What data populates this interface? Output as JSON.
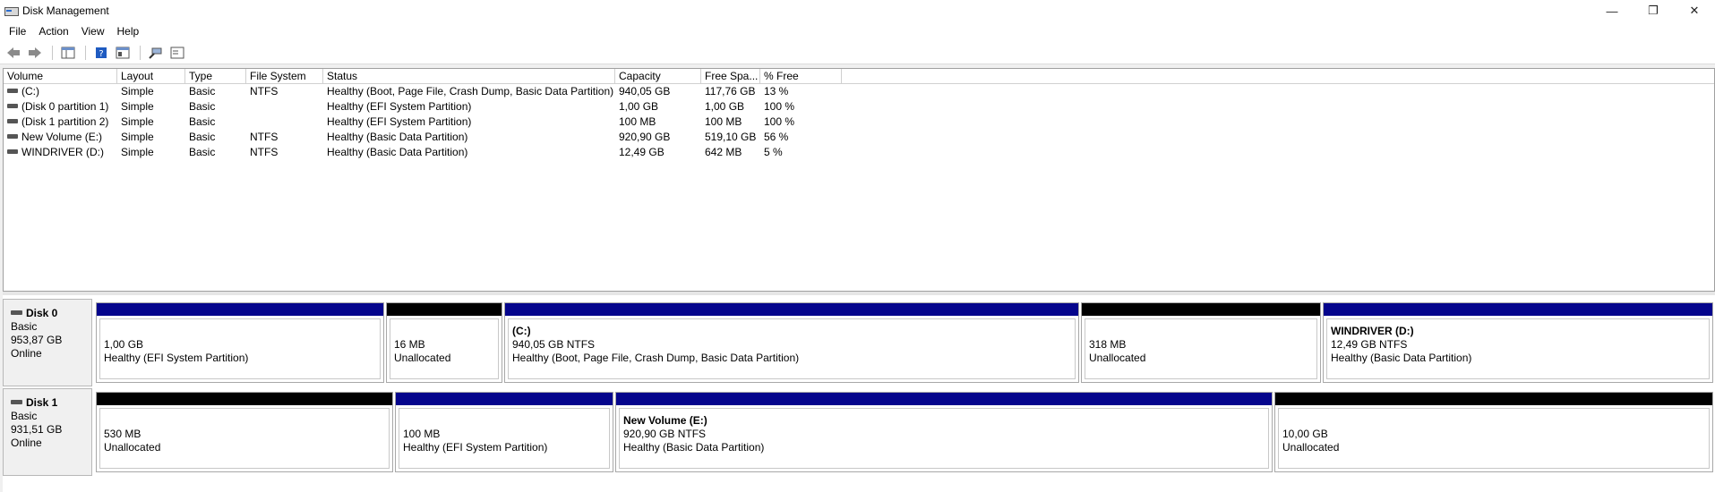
{
  "window": {
    "title": "Disk Management",
    "minimize": "—",
    "maximize": "❐",
    "close": "✕"
  },
  "menu": [
    "File",
    "Action",
    "View",
    "Help"
  ],
  "toolbar_icons": [
    "back-arrow-icon",
    "forward-arrow-icon",
    "console-tree-icon",
    "help-icon",
    "properties-icon",
    "rescan-icon",
    "disk-list-icon"
  ],
  "columns": [
    "Volume",
    "Layout",
    "Type",
    "File System",
    "Status",
    "Capacity",
    "Free Spa...",
    "% Free"
  ],
  "volumes": [
    {
      "volume": "(C:)",
      "layout": "Simple",
      "type": "Basic",
      "fs": "NTFS",
      "status": "Healthy (Boot, Page File, Crash Dump, Basic Data Partition)",
      "capacity": "940,05 GB",
      "free": "117,76 GB",
      "pct": "13 %"
    },
    {
      "volume": "(Disk 0 partition 1)",
      "layout": "Simple",
      "type": "Basic",
      "fs": "",
      "status": "Healthy (EFI System Partition)",
      "capacity": "1,00 GB",
      "free": "1,00 GB",
      "pct": "100 %"
    },
    {
      "volume": "(Disk 1 partition 2)",
      "layout": "Simple",
      "type": "Basic",
      "fs": "",
      "status": "Healthy (EFI System Partition)",
      "capacity": "100 MB",
      "free": "100 MB",
      "pct": "100 %"
    },
    {
      "volume": "New Volume (E:)",
      "layout": "Simple",
      "type": "Basic",
      "fs": "NTFS",
      "status": "Healthy (Basic Data Partition)",
      "capacity": "920,90 GB",
      "free": "519,10 GB",
      "pct": "56 %"
    },
    {
      "volume": "WINDRIVER (D:)",
      "layout": "Simple",
      "type": "Basic",
      "fs": "NTFS",
      "status": "Healthy (Basic Data Partition)",
      "capacity": "12,49 GB",
      "free": "642 MB",
      "pct": "5 %"
    }
  ],
  "disks": [
    {
      "name": "Disk 0",
      "type": "Basic",
      "size": "953,87 GB",
      "state": "Online",
      "partitions": [
        {
          "name": "",
          "size": "1,00 GB",
          "status": "Healthy (EFI System Partition)",
          "bar": "blue"
        },
        {
          "name": "",
          "size": "16 MB",
          "status": "Unallocated",
          "bar": "black"
        },
        {
          "name": "(C:)",
          "size": "940,05 GB NTFS",
          "status": "Healthy (Boot, Page File, Crash Dump, Basic Data Partition)",
          "bar": "blue"
        },
        {
          "name": "",
          "size": "318 MB",
          "status": "Unallocated",
          "bar": "black"
        },
        {
          "name": "WINDRIVER  (D:)",
          "size": "12,49 GB NTFS",
          "status": "Healthy (Basic Data Partition)",
          "bar": "blue"
        }
      ]
    },
    {
      "name": "Disk 1",
      "type": "Basic",
      "size": "931,51 GB",
      "state": "Online",
      "partitions": [
        {
          "name": "",
          "size": "530 MB",
          "status": "Unallocated",
          "bar": "black"
        },
        {
          "name": "",
          "size": "100 MB",
          "status": "Healthy (EFI System Partition)",
          "bar": "blue"
        },
        {
          "name": "New Volume  (E:)",
          "size": "920,90 GB NTFS",
          "status": "Healthy (Basic Data Partition)",
          "bar": "blue"
        },
        {
          "name": "",
          "size": "10,00 GB",
          "status": "Unallocated",
          "bar": "black"
        }
      ]
    }
  ],
  "colors": {
    "primary_partition": "#05058c",
    "unallocated": "#000000"
  }
}
